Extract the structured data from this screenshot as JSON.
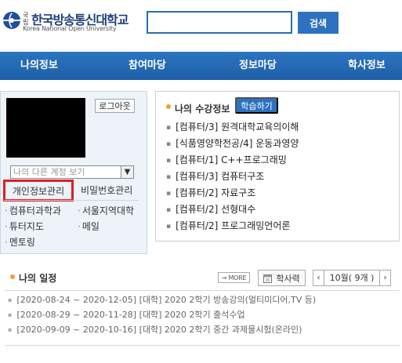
{
  "header": {
    "logo": {
      "prefix": "국립",
      "title": "한국방송통신대학교",
      "subtitle": "Korea National Open University"
    },
    "search": {
      "value": "",
      "button_label": "검색"
    }
  },
  "nav": {
    "items": [
      {
        "label": "나의정보"
      },
      {
        "label": "참여마당"
      },
      {
        "label": "정보마당"
      },
      {
        "label": "학사정보"
      }
    ]
  },
  "user_panel": {
    "logout_label": "로그아웃",
    "account_select": {
      "selected": "나의 다른 계정 보기"
    },
    "tabs": [
      {
        "label": "개인정보관리"
      },
      {
        "label": "비밀번호관리"
      }
    ],
    "links": [
      {
        "label": "컴퓨터과학과"
      },
      {
        "label": "서울지역대학"
      },
      {
        "label": "튜터지도"
      },
      {
        "label": "메일"
      },
      {
        "label": "멘토링"
      }
    ]
  },
  "courses": {
    "heading": "나의 수강정보",
    "study_button": "학습하기",
    "items": [
      {
        "label": "[컴퓨터/3] 원격대학교육의이해"
      },
      {
        "label": "[식품영양학전공/4] 운동과영양"
      },
      {
        "label": "[컴퓨터/1] C++프로그래밍"
      },
      {
        "label": "[컴퓨터/3] 컴퓨터구조"
      },
      {
        "label": "[컴퓨터/2] 자료구조"
      },
      {
        "label": "[컴퓨터/2] 선형대수"
      },
      {
        "label": "[컴퓨터/2] 프로그래밍언어론"
      }
    ]
  },
  "schedule": {
    "heading": "나의 일정",
    "more_label": "MORE",
    "calendar_label": "학사력",
    "month_label": "10월( 9개 )",
    "items": [
      {
        "label": "[2020-08-24 ~ 2020-12-05] [대학] 2020 2학기 방송강의(멀티미디어,TV 등)"
      },
      {
        "label": "[2020-08-29 ~ 2020-11-28] [대학] 2020 2학기 출석수업"
      },
      {
        "label": "[2020-09-09 ~ 2020-10-16] [대학] 2020 2학기 중간 과제물시험(온라인)"
      }
    ]
  },
  "colors": {
    "brand_blue": "#2d72bf",
    "highlight_red": "#e31c23",
    "bullet_orange": "#f0a030"
  }
}
